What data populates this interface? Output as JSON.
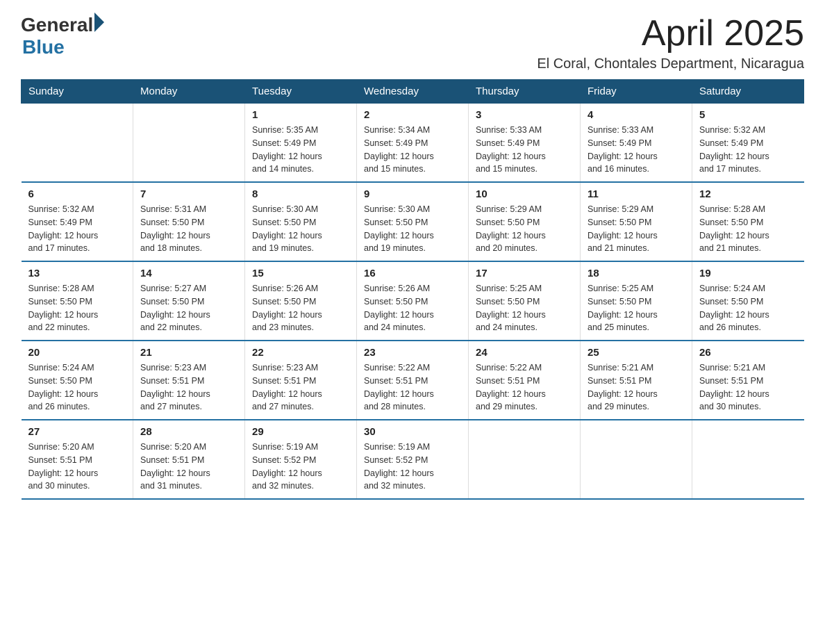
{
  "header": {
    "logo_general": "General",
    "logo_blue": "Blue",
    "month_title": "April 2025",
    "location": "El Coral, Chontales Department, Nicaragua"
  },
  "weekdays": [
    "Sunday",
    "Monday",
    "Tuesday",
    "Wednesday",
    "Thursday",
    "Friday",
    "Saturday"
  ],
  "weeks": [
    [
      {
        "day": "",
        "info": ""
      },
      {
        "day": "",
        "info": ""
      },
      {
        "day": "1",
        "info": "Sunrise: 5:35 AM\nSunset: 5:49 PM\nDaylight: 12 hours\nand 14 minutes."
      },
      {
        "day": "2",
        "info": "Sunrise: 5:34 AM\nSunset: 5:49 PM\nDaylight: 12 hours\nand 15 minutes."
      },
      {
        "day": "3",
        "info": "Sunrise: 5:33 AM\nSunset: 5:49 PM\nDaylight: 12 hours\nand 15 minutes."
      },
      {
        "day": "4",
        "info": "Sunrise: 5:33 AM\nSunset: 5:49 PM\nDaylight: 12 hours\nand 16 minutes."
      },
      {
        "day": "5",
        "info": "Sunrise: 5:32 AM\nSunset: 5:49 PM\nDaylight: 12 hours\nand 17 minutes."
      }
    ],
    [
      {
        "day": "6",
        "info": "Sunrise: 5:32 AM\nSunset: 5:49 PM\nDaylight: 12 hours\nand 17 minutes."
      },
      {
        "day": "7",
        "info": "Sunrise: 5:31 AM\nSunset: 5:50 PM\nDaylight: 12 hours\nand 18 minutes."
      },
      {
        "day": "8",
        "info": "Sunrise: 5:30 AM\nSunset: 5:50 PM\nDaylight: 12 hours\nand 19 minutes."
      },
      {
        "day": "9",
        "info": "Sunrise: 5:30 AM\nSunset: 5:50 PM\nDaylight: 12 hours\nand 19 minutes."
      },
      {
        "day": "10",
        "info": "Sunrise: 5:29 AM\nSunset: 5:50 PM\nDaylight: 12 hours\nand 20 minutes."
      },
      {
        "day": "11",
        "info": "Sunrise: 5:29 AM\nSunset: 5:50 PM\nDaylight: 12 hours\nand 21 minutes."
      },
      {
        "day": "12",
        "info": "Sunrise: 5:28 AM\nSunset: 5:50 PM\nDaylight: 12 hours\nand 21 minutes."
      }
    ],
    [
      {
        "day": "13",
        "info": "Sunrise: 5:28 AM\nSunset: 5:50 PM\nDaylight: 12 hours\nand 22 minutes."
      },
      {
        "day": "14",
        "info": "Sunrise: 5:27 AM\nSunset: 5:50 PM\nDaylight: 12 hours\nand 22 minutes."
      },
      {
        "day": "15",
        "info": "Sunrise: 5:26 AM\nSunset: 5:50 PM\nDaylight: 12 hours\nand 23 minutes."
      },
      {
        "day": "16",
        "info": "Sunrise: 5:26 AM\nSunset: 5:50 PM\nDaylight: 12 hours\nand 24 minutes."
      },
      {
        "day": "17",
        "info": "Sunrise: 5:25 AM\nSunset: 5:50 PM\nDaylight: 12 hours\nand 24 minutes."
      },
      {
        "day": "18",
        "info": "Sunrise: 5:25 AM\nSunset: 5:50 PM\nDaylight: 12 hours\nand 25 minutes."
      },
      {
        "day": "19",
        "info": "Sunrise: 5:24 AM\nSunset: 5:50 PM\nDaylight: 12 hours\nand 26 minutes."
      }
    ],
    [
      {
        "day": "20",
        "info": "Sunrise: 5:24 AM\nSunset: 5:50 PM\nDaylight: 12 hours\nand 26 minutes."
      },
      {
        "day": "21",
        "info": "Sunrise: 5:23 AM\nSunset: 5:51 PM\nDaylight: 12 hours\nand 27 minutes."
      },
      {
        "day": "22",
        "info": "Sunrise: 5:23 AM\nSunset: 5:51 PM\nDaylight: 12 hours\nand 27 minutes."
      },
      {
        "day": "23",
        "info": "Sunrise: 5:22 AM\nSunset: 5:51 PM\nDaylight: 12 hours\nand 28 minutes."
      },
      {
        "day": "24",
        "info": "Sunrise: 5:22 AM\nSunset: 5:51 PM\nDaylight: 12 hours\nand 29 minutes."
      },
      {
        "day": "25",
        "info": "Sunrise: 5:21 AM\nSunset: 5:51 PM\nDaylight: 12 hours\nand 29 minutes."
      },
      {
        "day": "26",
        "info": "Sunrise: 5:21 AM\nSunset: 5:51 PM\nDaylight: 12 hours\nand 30 minutes."
      }
    ],
    [
      {
        "day": "27",
        "info": "Sunrise: 5:20 AM\nSunset: 5:51 PM\nDaylight: 12 hours\nand 30 minutes."
      },
      {
        "day": "28",
        "info": "Sunrise: 5:20 AM\nSunset: 5:51 PM\nDaylight: 12 hours\nand 31 minutes."
      },
      {
        "day": "29",
        "info": "Sunrise: 5:19 AM\nSunset: 5:52 PM\nDaylight: 12 hours\nand 32 minutes."
      },
      {
        "day": "30",
        "info": "Sunrise: 5:19 AM\nSunset: 5:52 PM\nDaylight: 12 hours\nand 32 minutes."
      },
      {
        "day": "",
        "info": ""
      },
      {
        "day": "",
        "info": ""
      },
      {
        "day": "",
        "info": ""
      }
    ]
  ]
}
